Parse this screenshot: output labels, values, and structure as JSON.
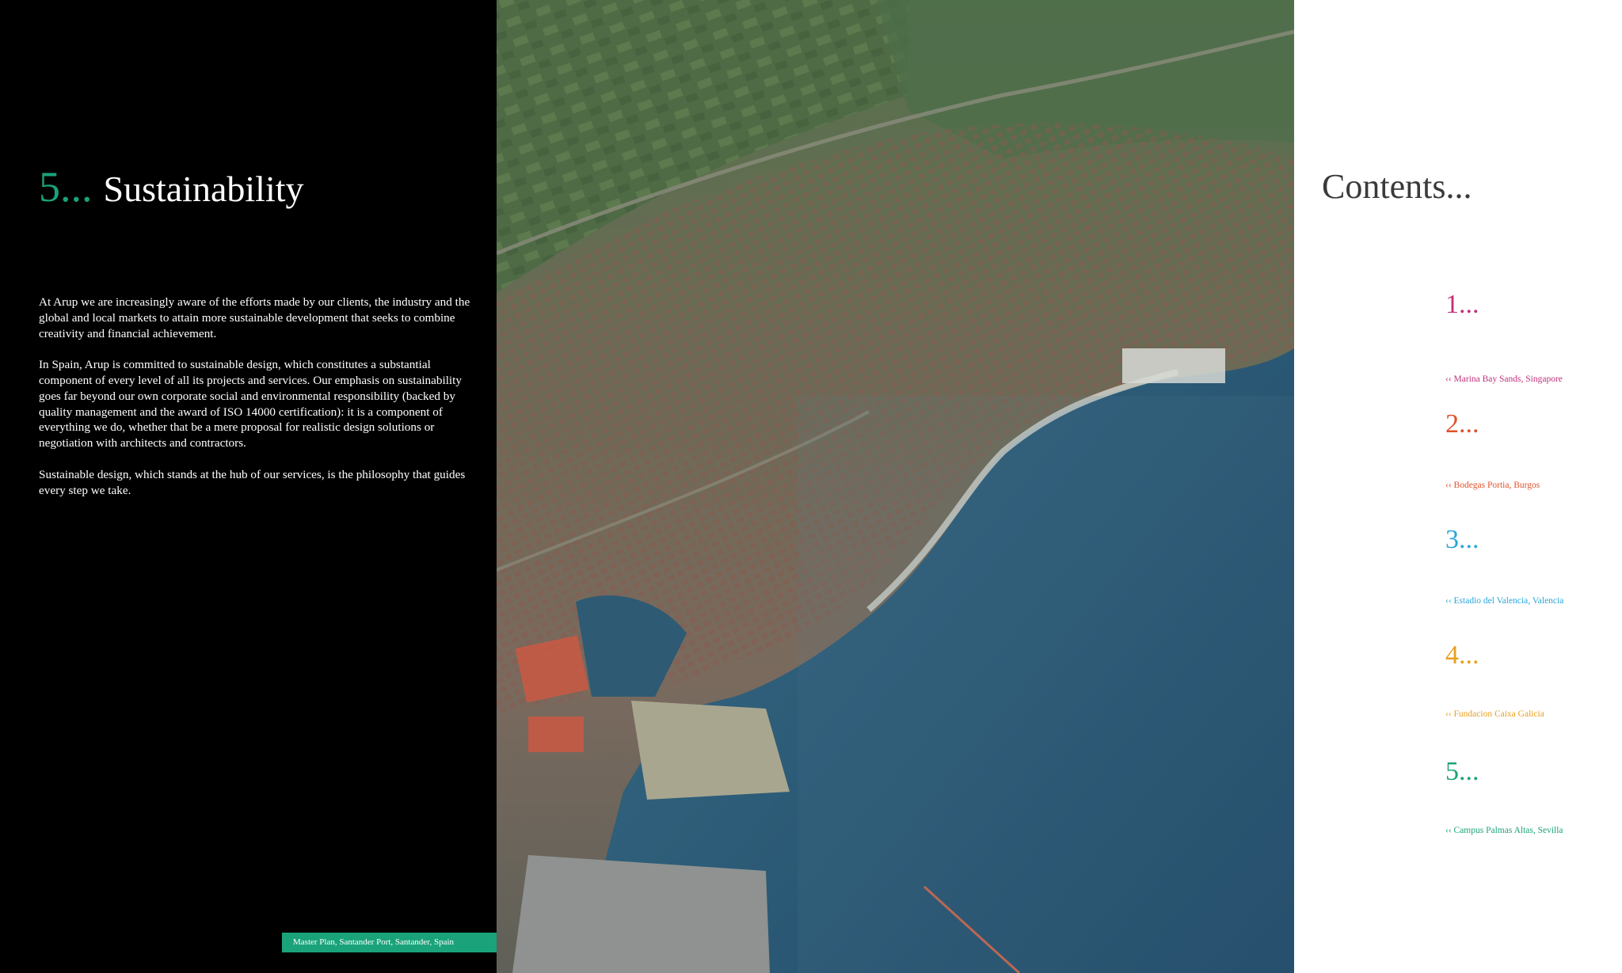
{
  "section": {
    "number": "5...",
    "title": "Sustainability",
    "paragraphs": [
      "At Arup we are increasingly aware of the efforts made by our clients, the industry and the global and local markets to attain more sustainable development that seeks to combine creativity and financial achievement.",
      "In Spain, Arup is committed to sustainable design, which constitutes a substantial component of every level of all its projects and services. Our emphasis on sustainability goes far beyond our own corporate social and environmental responsibility (backed by quality management and the award of ISO 14000 certification): it is a component of everything we do, whether that be a mere proposal for realistic design solutions or negotiation with architects and contractors.",
      "Sustainable design, which stands at the hub of our services, is the philosophy that guides every step we take."
    ],
    "caption": "Master Plan, Santander Port, Santander, Spain"
  },
  "contents": {
    "title": "Contents...",
    "items": [
      {
        "number": "1...",
        "label": "‹‹ Marina Bay Sands, Singapore",
        "color": "#c2307a"
      },
      {
        "number": "2...",
        "label": "‹‹ Bodegas Portia, Burgos",
        "color": "#e0522a"
      },
      {
        "number": "3...",
        "label": "‹‹ Estadio del Valencia, Valencia",
        "color": "#2aa6d8"
      },
      {
        "number": "4...",
        "label": "‹‹ Fundacion Caixa Galicia",
        "color": "#e8a020"
      },
      {
        "number": "5...",
        "label": "‹‹ Campus Palmas Altas, Sevilla",
        "color": "#1aa37a"
      }
    ]
  },
  "colors": {
    "accent_green": "#1aa37a",
    "panel_black": "#000000"
  }
}
